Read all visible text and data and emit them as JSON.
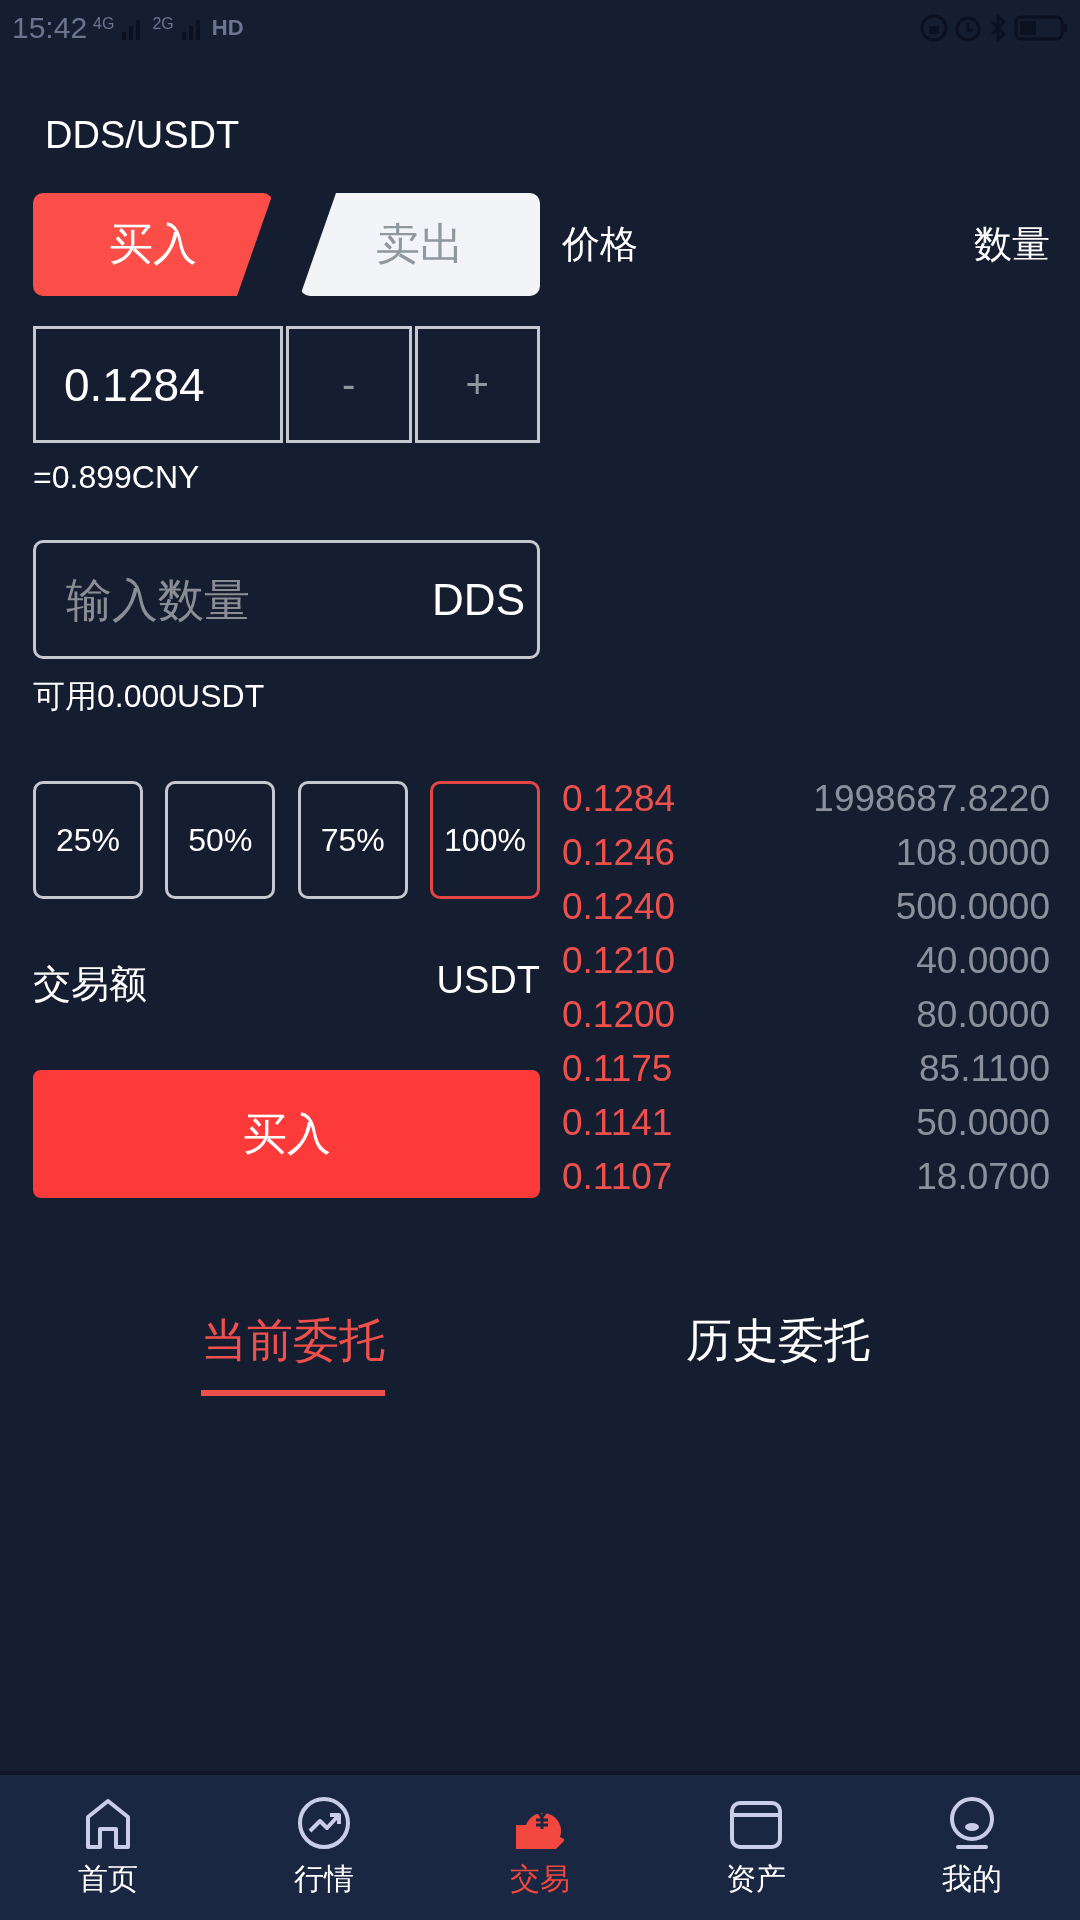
{
  "status_bar": {
    "time": "15:42",
    "networks": [
      "4G",
      "2G"
    ],
    "hd": "HD"
  },
  "pair": "DDS/USDT",
  "side_tabs": [
    {
      "label": "买入",
      "selected": true
    },
    {
      "label": "卖出",
      "selected": false
    }
  ],
  "price": {
    "value": "0.1284",
    "minus": "-",
    "plus": "+",
    "cny": "=0.899CNY"
  },
  "quantity": {
    "placeholder": "输入数量",
    "unit": "DDS",
    "available": "可用0.000USDT"
  },
  "percent_options": [
    {
      "label": "25%",
      "selected": false
    },
    {
      "label": "50%",
      "selected": false
    },
    {
      "label": "75%",
      "selected": false
    },
    {
      "label": "100%",
      "selected": true
    }
  ],
  "total": {
    "label": "交易额",
    "unit": "USDT"
  },
  "submit": "买入",
  "order_book": {
    "columns": [
      "价格",
      "数量"
    ],
    "rows": [
      {
        "price": "0.1284",
        "amount": "1998687.8220"
      },
      {
        "price": "0.1246",
        "amount": "108.0000"
      },
      {
        "price": "0.1240",
        "amount": "500.0000"
      },
      {
        "price": "0.1210",
        "amount": "40.0000"
      },
      {
        "price": "0.1200",
        "amount": "80.0000"
      },
      {
        "price": "0.1175",
        "amount": "85.1100"
      },
      {
        "price": "0.1141",
        "amount": "50.0000"
      },
      {
        "price": "0.1107",
        "amount": "18.0700"
      }
    ]
  },
  "order_tabs": [
    {
      "label": "当前委托",
      "selected": true
    },
    {
      "label": "历史委托",
      "selected": false
    }
  ],
  "nav": [
    {
      "label": "首页",
      "kind": "home",
      "selected": false
    },
    {
      "label": "行情",
      "kind": "chart",
      "selected": false
    },
    {
      "label": "交易",
      "kind": "trade",
      "selected": true
    },
    {
      "label": "资产",
      "kind": "wallet",
      "selected": false
    },
    {
      "label": "我的",
      "kind": "user",
      "selected": false
    }
  ]
}
